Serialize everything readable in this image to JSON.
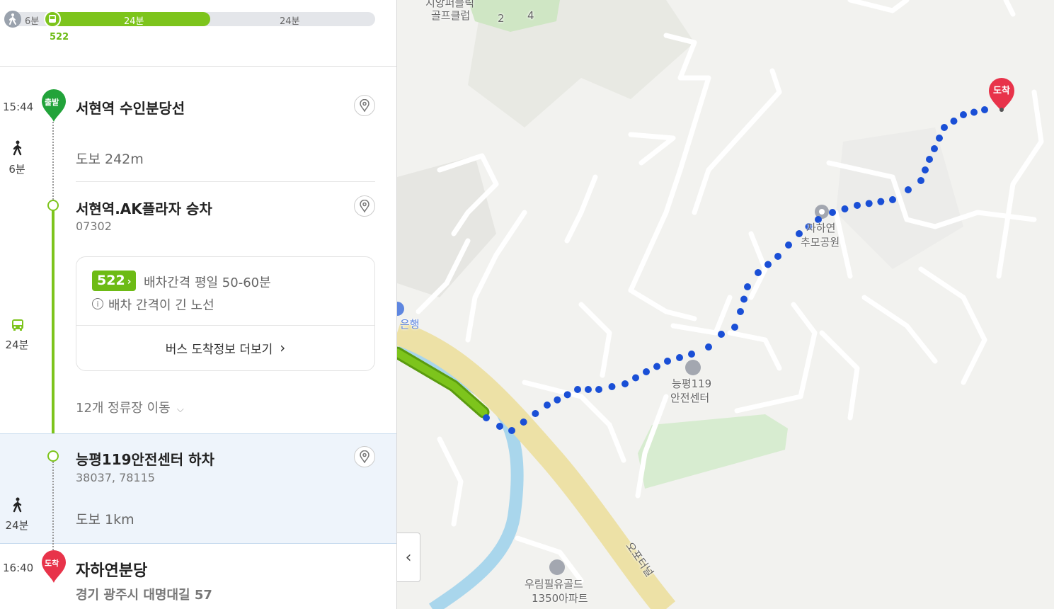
{
  "summary": {
    "walk1": "6분",
    "bus": "24분",
    "walk2": "24분",
    "bus_no": "522"
  },
  "steps": {
    "start": {
      "time": "15:44",
      "pin": "출발",
      "name": "서현역 수인분당선",
      "walk_time": "6분",
      "walk_dist": "도보 242m"
    },
    "board": {
      "name": "서현역.AK플라자 승차",
      "code": "07302"
    },
    "bus_card": {
      "number": "522",
      "interval": "배차간격 평일 50-60분",
      "notice": "배차 간격이 긴 노선",
      "more": "버스 도착정보 더보기"
    },
    "bus_time": "24분",
    "stops": "12개 정류장 이동",
    "alight": {
      "name": "능평119안전센터 하차",
      "code": "38037, 78115",
      "walk_time": "24분",
      "walk_dist": "도보 1km"
    },
    "end": {
      "time": "16:40",
      "pin": "도착",
      "name": "자하연분당",
      "address": "경기 광주시 대명대길 57"
    }
  },
  "map": {
    "labels": {
      "golf1": "지앙퍼블릭",
      "golf2": "골프클럽",
      "n2": "2",
      "n4": "4",
      "park1": "자하연",
      "park2": "추모공원",
      "bank": "은행",
      "fire1": "능평119",
      "fire2": "안전센터",
      "apt1": "우림필유골드",
      "apt2": "1350아파트",
      "tunnel": "오포터널",
      "dest_pin": "도착"
    }
  },
  "colors": {
    "bus_green": "#7dc41c",
    "start_pin": "#22a33a",
    "end_pin": "#e8334a",
    "walk_route": "#1a4fd6",
    "selected_bg": "#eef4fb"
  }
}
